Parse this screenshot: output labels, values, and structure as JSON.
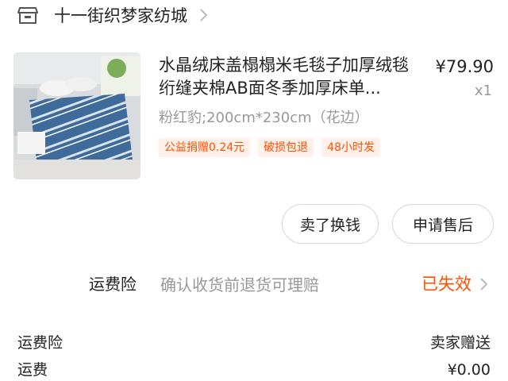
{
  "shop": {
    "name": "十一街织梦家纺城",
    "icon": "store-icon",
    "chevron_icon": "chevron-right-icon"
  },
  "product": {
    "title": "水晶绒床盖榻榻米毛毯子加厚绒毯绗缝夹棉AB面冬季加厚床单...",
    "price": "¥79.90",
    "quantity": "x1",
    "sku": "粉红豹;200cm*230cm（花边）",
    "tags": [
      "公益捐赠0.24元",
      "破损包退",
      "48小时发"
    ],
    "image": "bed-blanket-product-photo"
  },
  "actions": {
    "resell_label": "卖了换钱",
    "aftersale_label": "申请售后"
  },
  "insurance": {
    "label": "运费险",
    "description": "确认收货前退货可理赔",
    "status": "已失效",
    "chevron_icon": "chevron-right-icon"
  },
  "fees": [
    {
      "label": "运费险",
      "value": "卖家赠送"
    },
    {
      "label": "运费",
      "value": "¥0.00"
    }
  ],
  "colors": {
    "accent": "#ff5000",
    "tag_background": "#fff1ea",
    "muted_text": "#999999"
  }
}
